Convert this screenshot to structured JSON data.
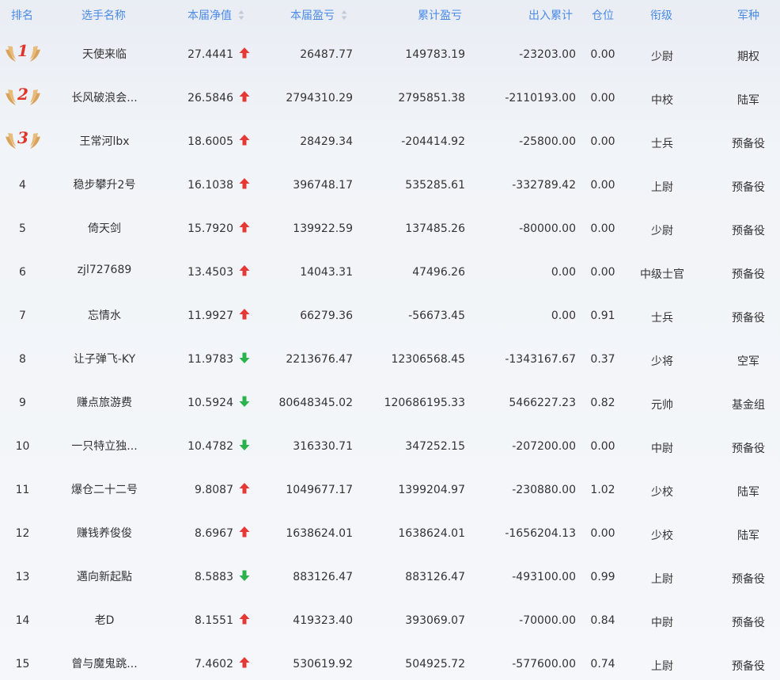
{
  "header": {
    "rank": "排名",
    "name": "选手名称",
    "nav": "本届净值",
    "pnl": "本届盈亏",
    "cum": "累计盈亏",
    "flow": "出入累计",
    "pos": "仓位",
    "title": "衔级",
    "branch": "军种"
  },
  "colors": {
    "header_text": "#4a8be6",
    "arrow_up": "#e53935",
    "arrow_down": "#2bb24c",
    "medal_number": "#e0342a",
    "wing": "#d9a25a"
  },
  "rows": [
    {
      "rank": "1",
      "medal": true,
      "name": "天使来临",
      "nav": "27.4441",
      "trend": "up",
      "pnl": "26487.77",
      "cum": "149783.19",
      "flow": "-23203.00",
      "pos": "0.00",
      "title": "少尉",
      "branch": "期权"
    },
    {
      "rank": "2",
      "medal": true,
      "name": "长风破浪会...",
      "nav": "26.5846",
      "trend": "up",
      "pnl": "2794310.29",
      "cum": "2795851.38",
      "flow": "-2110193.00",
      "pos": "0.00",
      "title": "中校",
      "branch": "陆军"
    },
    {
      "rank": "3",
      "medal": true,
      "name": "王常河lbx",
      "nav": "18.6005",
      "trend": "up",
      "pnl": "28429.34",
      "cum": "-204414.92",
      "flow": "-25800.00",
      "pos": "0.00",
      "title": "士兵",
      "branch": "预备役"
    },
    {
      "rank": "4",
      "medal": false,
      "name": "稳步攀升2号",
      "nav": "16.1038",
      "trend": "up",
      "pnl": "396748.17",
      "cum": "535285.61",
      "flow": "-332789.42",
      "pos": "0.00",
      "title": "上尉",
      "branch": "预备役"
    },
    {
      "rank": "5",
      "medal": false,
      "name": "倚天剑",
      "nav": "15.7920",
      "trend": "up",
      "pnl": "139922.59",
      "cum": "137485.26",
      "flow": "-80000.00",
      "pos": "0.00",
      "title": "少尉",
      "branch": "预备役"
    },
    {
      "rank": "6",
      "medal": false,
      "name": "zjl727689",
      "nav": "13.4503",
      "trend": "up",
      "pnl": "14043.31",
      "cum": "47496.26",
      "flow": "0.00",
      "pos": "0.00",
      "title": "中级士官",
      "branch": "预备役"
    },
    {
      "rank": "7",
      "medal": false,
      "name": "忘情水",
      "nav": "11.9927",
      "trend": "up",
      "pnl": "66279.36",
      "cum": "-56673.45",
      "flow": "0.00",
      "pos": "0.91",
      "title": "士兵",
      "branch": "预备役"
    },
    {
      "rank": "8",
      "medal": false,
      "name": "让子弹飞-KY",
      "nav": "11.9783",
      "trend": "down",
      "pnl": "2213676.47",
      "cum": "12306568.45",
      "flow": "-1343167.67",
      "pos": "0.37",
      "title": "少将",
      "branch": "空军"
    },
    {
      "rank": "9",
      "medal": false,
      "name": "赚点旅游费",
      "nav": "10.5924",
      "trend": "down",
      "pnl": "80648345.02",
      "cum": "120686195.33",
      "flow": "5466227.23",
      "pos": "0.82",
      "title": "元帅",
      "branch": "基金组"
    },
    {
      "rank": "10",
      "medal": false,
      "name": "一只特立独...",
      "nav": "10.4782",
      "trend": "down",
      "pnl": "316330.71",
      "cum": "347252.15",
      "flow": "-207200.00",
      "pos": "0.00",
      "title": "中尉",
      "branch": "预备役"
    },
    {
      "rank": "11",
      "medal": false,
      "name": "爆仓二十二号",
      "nav": "9.8087",
      "trend": "up",
      "pnl": "1049677.17",
      "cum": "1399204.97",
      "flow": "-230880.00",
      "pos": "1.02",
      "title": "少校",
      "branch": "陆军"
    },
    {
      "rank": "12",
      "medal": false,
      "name": "赚钱养俊俊",
      "nav": "8.6967",
      "trend": "up",
      "pnl": "1638624.01",
      "cum": "1638624.01",
      "flow": "-1656204.13",
      "pos": "0.00",
      "title": "少校",
      "branch": "陆军"
    },
    {
      "rank": "13",
      "medal": false,
      "name": "邁向新起點",
      "nav": "8.5883",
      "trend": "down",
      "pnl": "883126.47",
      "cum": "883126.47",
      "flow": "-493100.00",
      "pos": "0.99",
      "title": "上尉",
      "branch": "预备役"
    },
    {
      "rank": "14",
      "medal": false,
      "name": "老D",
      "nav": "8.1551",
      "trend": "up",
      "pnl": "419323.40",
      "cum": "393069.07",
      "flow": "-70000.00",
      "pos": "0.84",
      "title": "中尉",
      "branch": "预备役"
    },
    {
      "rank": "15",
      "medal": false,
      "name": "曾与魔鬼跳...",
      "nav": "7.4602",
      "trend": "up",
      "pnl": "530619.92",
      "cum": "504925.72",
      "flow": "-577600.00",
      "pos": "0.74",
      "title": "上尉",
      "branch": "预备役"
    }
  ]
}
